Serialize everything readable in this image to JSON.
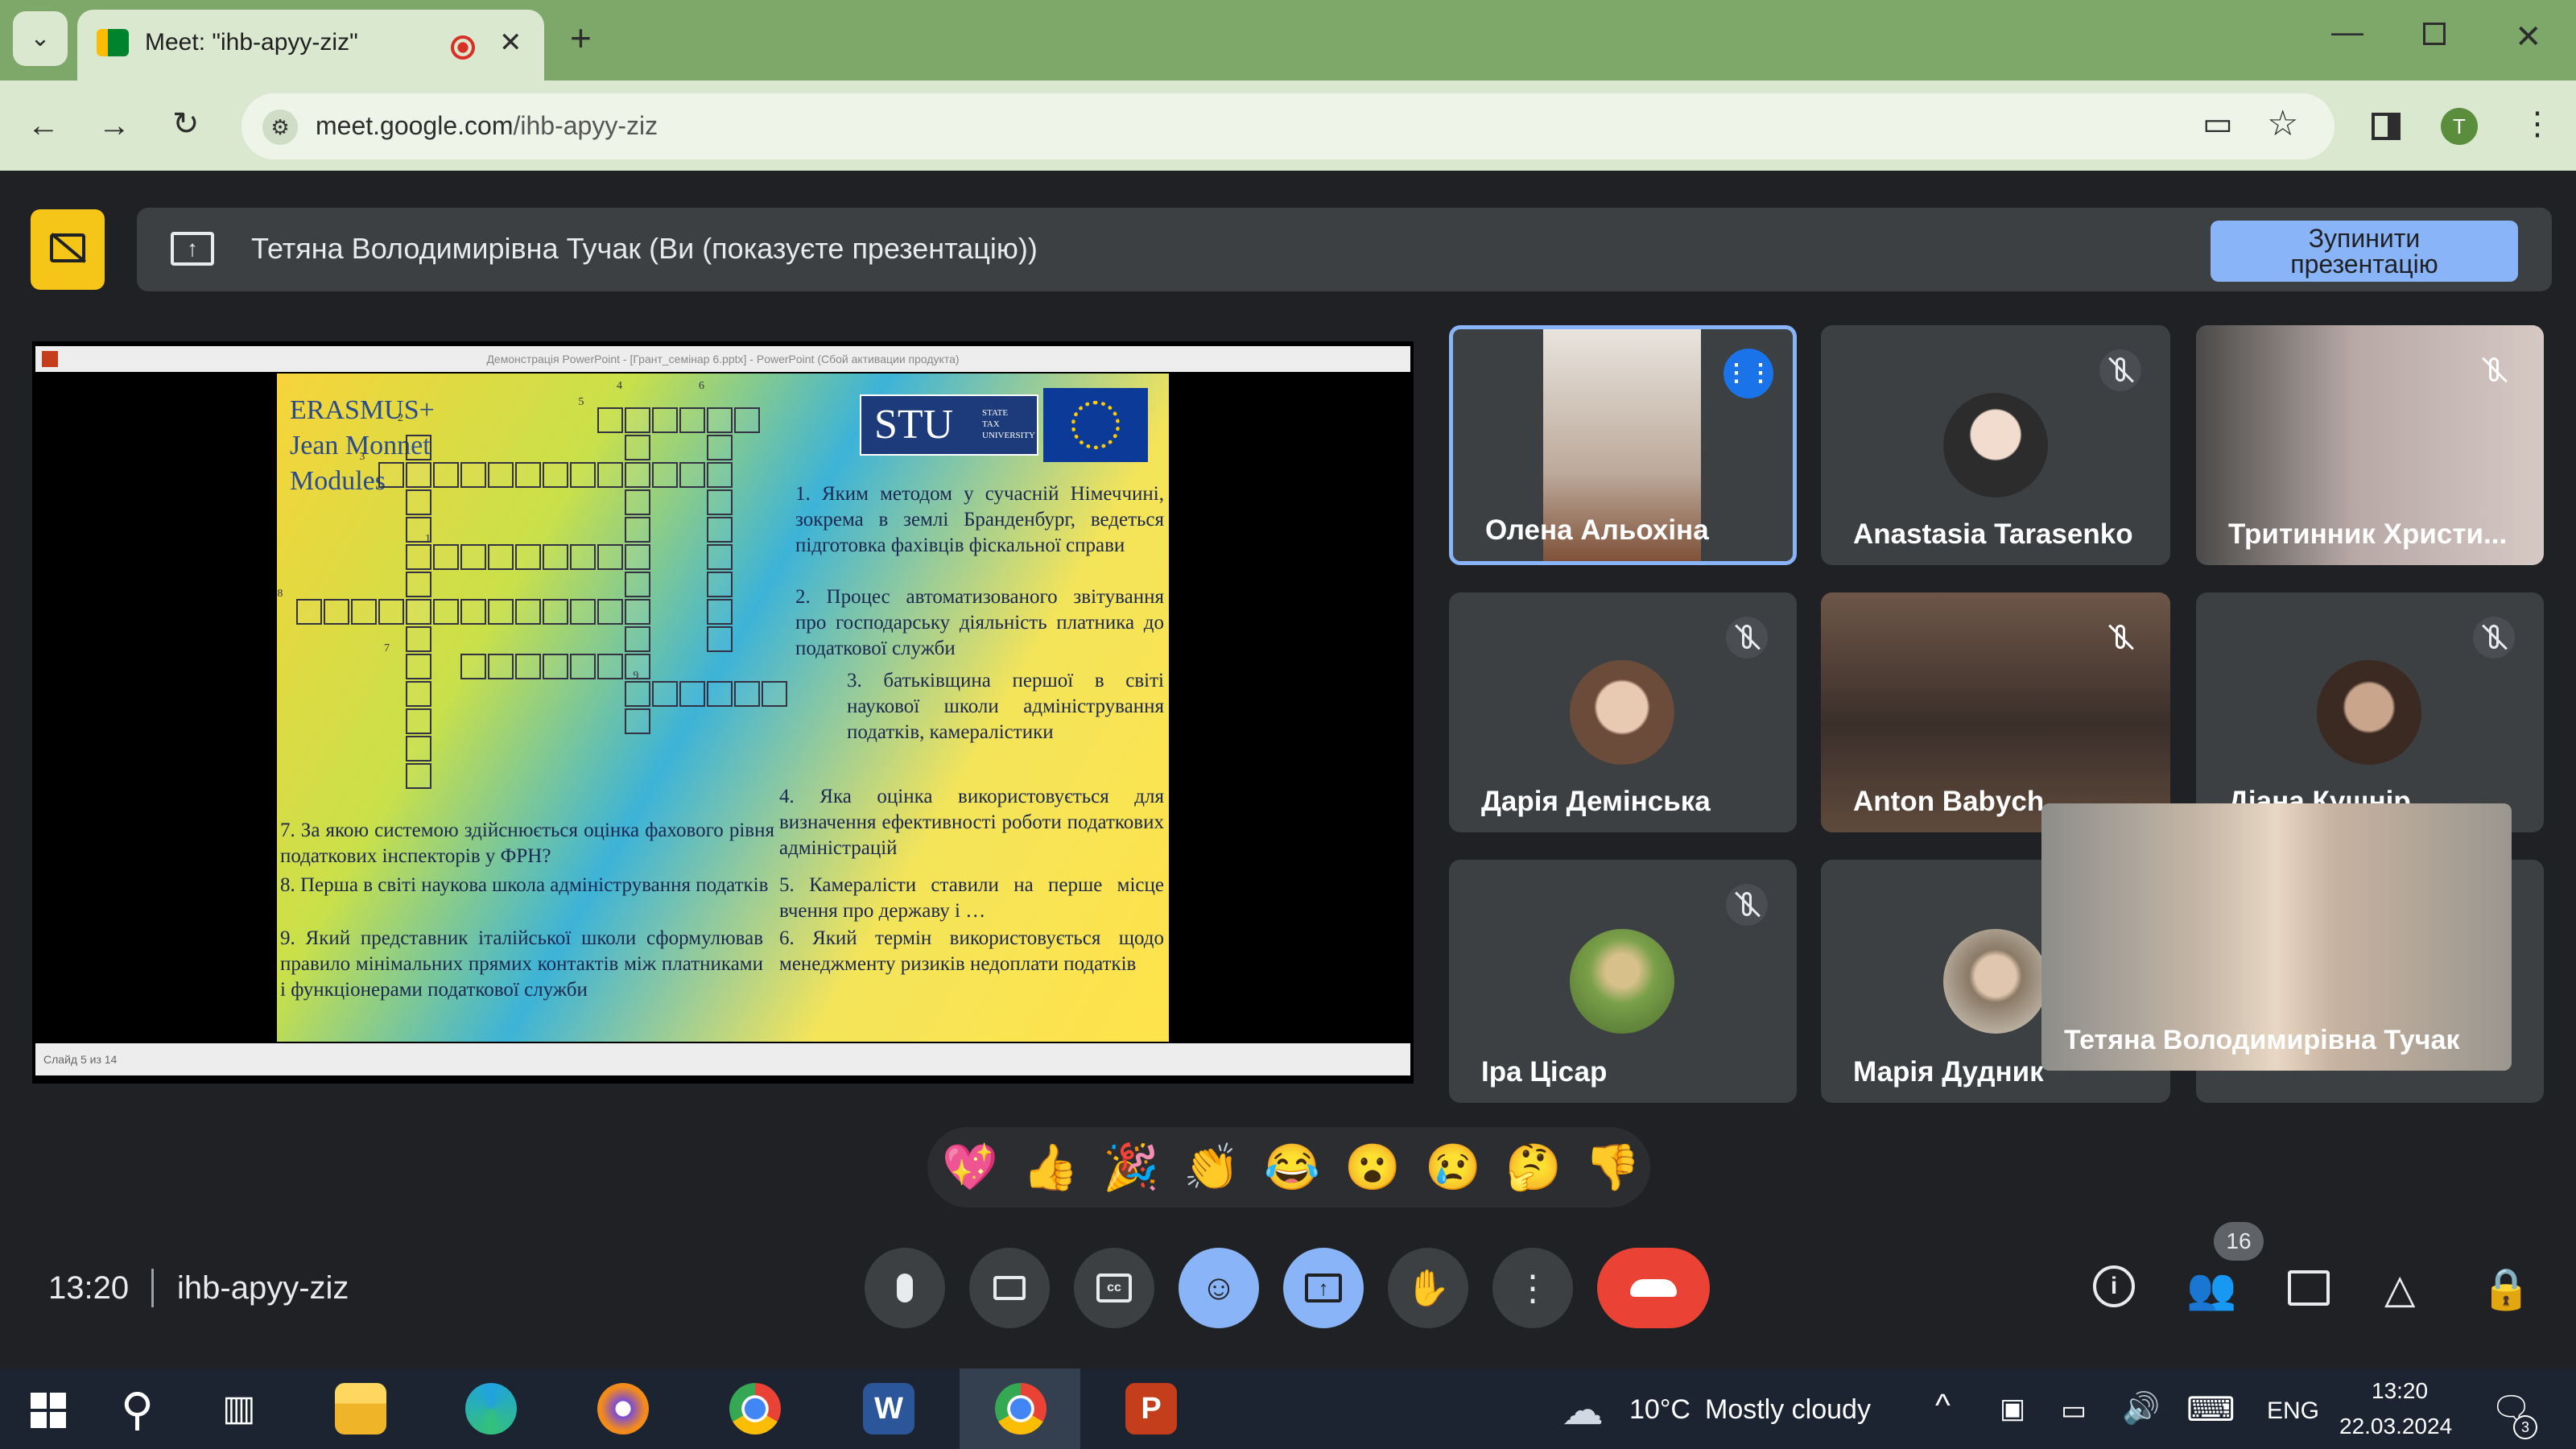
{
  "browser": {
    "tab_title": "Meet: \"ihb-apyy-ziz\"",
    "new_tab": "+",
    "url_host": "meet.google.com",
    "url_path": "/ihb-apyy-ziz",
    "profile_initial": "T"
  },
  "presentation_bar": {
    "title": "Тетяна Володимирівна Тучак (Ви (показуєте презентацію))",
    "stop_button_line1": "Зупинити",
    "stop_button_line2": "презентацію"
  },
  "slide": {
    "window_title": "Демонстрація PowerPoint - [Грант_семінар 6.pptx] - PowerPoint (Сбой активации продукта)",
    "status": "Слайд 5 из 14",
    "erasmus_lines": [
      "ERASMUS+",
      "Jean Monnet",
      "Modules"
    ],
    "logo_text": "STU",
    "logo_sub": [
      "STATE",
      "TAX",
      "UNIVERSITY"
    ],
    "crossword_numbers": [
      "1",
      "2",
      "3",
      "4",
      "5",
      "6",
      "7",
      "8",
      "9"
    ],
    "questions_right": [
      "1.  Яким методом у сучасній Німеччині, зокрема в землі Бранденбург, ведеться підготовка фахівців фіскальної справи",
      "2.  Процес автоматизованого звітування про господарську діяльність платника до податкової служби",
      "3.  батьківщина першої в світі наукової школи адміністрування податків, камералістики",
      "4.  Яка оцінка використовується для визначення ефективності роботи податкових адміністрацій",
      "5.  Камералісти ставили на перше місце вчення про державу і …",
      "6.  Який термін використовується щодо менеджменту ризиків недоплати податків"
    ],
    "questions_left": [
      "7.  За якою системою здійснюється оцінка фахового рівня податкових інспекторів у ФРН?",
      "8.  Перша в світі наукова школа адміністрування податків",
      "9.  Який представник італійської школи сформулював правило мінімальних прямих контактів між платниками і функціонерами податкової служби"
    ]
  },
  "participants": [
    {
      "name": "Олена Альохіна",
      "speaking": true
    },
    {
      "name": "Anastasia Tarasenko",
      "muted": true
    },
    {
      "name": "Тритинник Христи...",
      "muted": true
    },
    {
      "name": "Дарія Демінська",
      "muted": true
    },
    {
      "name": "Anton Babych",
      "muted": true
    },
    {
      "name": "Діана Кушнір",
      "muted": true
    },
    {
      "name": "Іра Цісар",
      "muted": true
    },
    {
      "name": "Марія Дудник",
      "muted": false
    },
    {
      "name": "Тетяна Володимирівна Тучак",
      "self": true
    }
  ],
  "reactions": [
    "💖",
    "👍",
    "🎉",
    "👏",
    "😂",
    "😮",
    "😢",
    "🤔",
    "👎"
  ],
  "meeting": {
    "time": "13:20",
    "code": "ihb-apyy-ziz",
    "participant_count": "16"
  },
  "taskbar": {
    "weather_temp": "10°C",
    "weather_desc": "Mostly cloudy",
    "lang": "ENG",
    "clock_time": "13:20",
    "clock_date": "22.03.2024",
    "notifications": "3"
  },
  "colors": {
    "chrome_tab_strip": "#7ea86a",
    "meet_bg": "#202124",
    "accent_blue": "#8ab4f8",
    "end_call_red": "#ea4335",
    "presenting_yellow": "#f5c518"
  }
}
